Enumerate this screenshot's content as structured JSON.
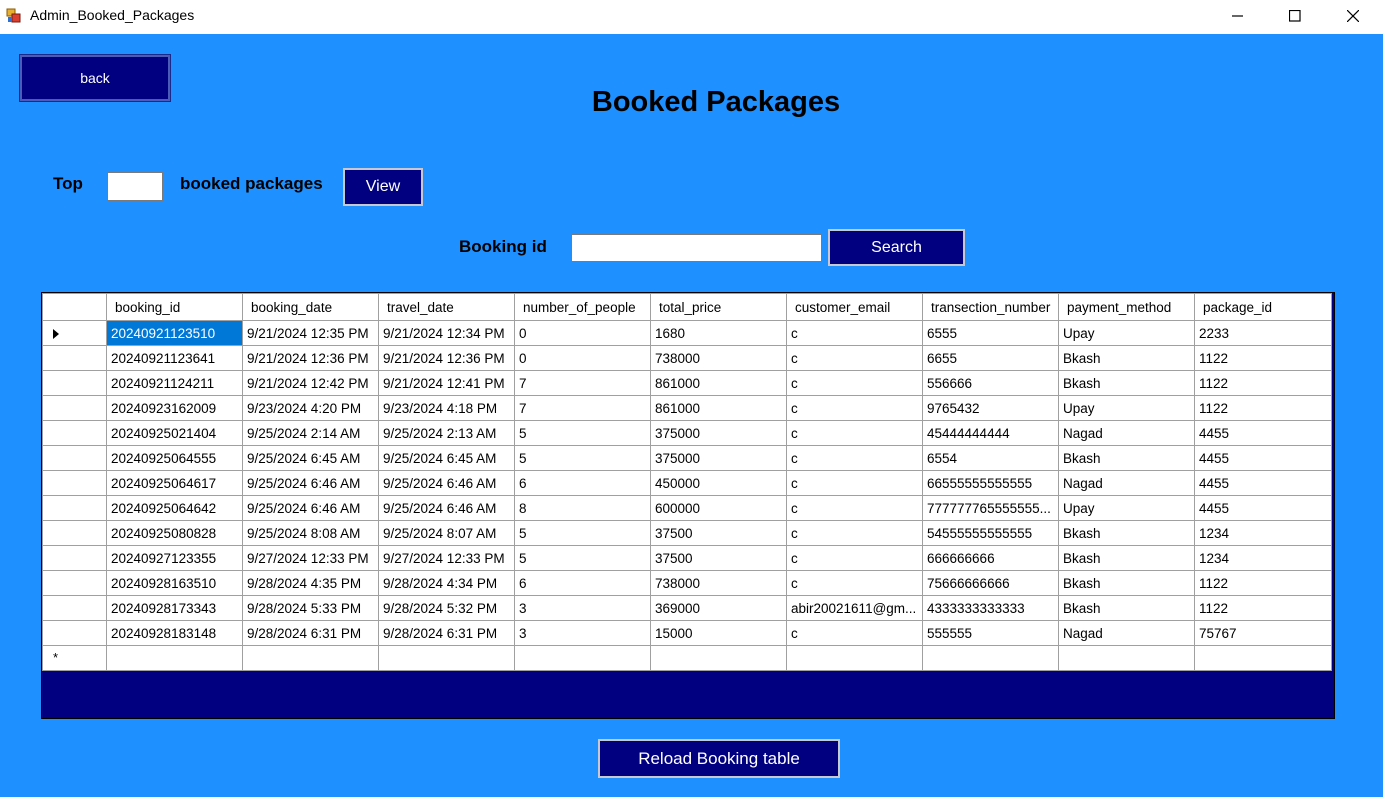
{
  "window": {
    "title": "Admin_Booked_Packages"
  },
  "buttons": {
    "back": "back",
    "view": "View",
    "search": "Search",
    "reload": "Reload Booking table"
  },
  "page_title": "Booked Packages",
  "filters": {
    "top_label": "Top",
    "booked_label": "booked packages",
    "booking_id_label": "Booking id",
    "top_value": "",
    "booking_id_value": ""
  },
  "table": {
    "columns": [
      "booking_id",
      "booking_date",
      "travel_date",
      "number_of_people",
      "total_price",
      "customer_email",
      "transection_number",
      "payment_method",
      "package_id"
    ],
    "rows": [
      [
        "20240921123510",
        "9/21/2024 12:35 PM",
        "9/21/2024 12:34 PM",
        "0",
        "1680",
        "c",
        "6555",
        "Upay",
        "2233"
      ],
      [
        "20240921123641",
        "9/21/2024 12:36 PM",
        "9/21/2024 12:36 PM",
        "0",
        "738000",
        "c",
        "6655",
        "Bkash",
        "1122"
      ],
      [
        "20240921124211",
        "9/21/2024 12:42 PM",
        "9/21/2024 12:41 PM",
        "7",
        "861000",
        "c",
        "556666",
        "Bkash",
        "1122"
      ],
      [
        "20240923162009",
        "9/23/2024 4:20 PM",
        "9/23/2024 4:18 PM",
        "7",
        "861000",
        "c",
        "9765432",
        "Upay",
        "1122"
      ],
      [
        "20240925021404",
        "9/25/2024 2:14 AM",
        "9/25/2024 2:13 AM",
        "5",
        "375000",
        "c",
        "45444444444",
        "Nagad",
        "4455"
      ],
      [
        "20240925064555",
        "9/25/2024 6:45 AM",
        "9/25/2024 6:45 AM",
        "5",
        "375000",
        "c",
        "6554",
        "Bkash",
        "4455"
      ],
      [
        "20240925064617",
        "9/25/2024 6:46 AM",
        "9/25/2024 6:46 AM",
        "6",
        "450000",
        "c",
        "66555555555555",
        "Nagad",
        "4455"
      ],
      [
        "20240925064642",
        "9/25/2024 6:46 AM",
        "9/25/2024 6:46 AM",
        "8",
        "600000",
        "c",
        "777777765555555...",
        "Upay",
        "4455"
      ],
      [
        "20240925080828",
        "9/25/2024 8:08 AM",
        "9/25/2024 8:07 AM",
        "5",
        "37500",
        "c",
        "54555555555555",
        "Bkash",
        "1234"
      ],
      [
        "20240927123355",
        "9/27/2024 12:33 PM",
        "9/27/2024 12:33 PM",
        "5",
        "37500",
        "c",
        "666666666",
        "Bkash",
        "1234"
      ],
      [
        "20240928163510",
        "9/28/2024 4:35 PM",
        "9/28/2024 4:34 PM",
        "6",
        "738000",
        "c",
        "75666666666",
        "Bkash",
        "1122"
      ],
      [
        "20240928173343",
        "9/28/2024 5:33 PM",
        "9/28/2024 5:32 PM",
        "3",
        "369000",
        "abir20021611@gm...",
        "4333333333333",
        "Bkash",
        "1122"
      ],
      [
        "20240928183148",
        "9/28/2024 6:31 PM",
        "9/28/2024 6:31 PM",
        "3",
        "15000",
        "c",
        "555555",
        "Nagad",
        "75767"
      ]
    ],
    "new_row_marker": "*"
  },
  "colors": {
    "background": "#1e90ff",
    "button": "#000080",
    "selection": "#0078d7"
  }
}
